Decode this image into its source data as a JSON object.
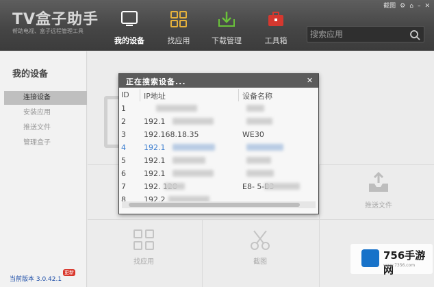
{
  "app": {
    "logo_title": "TV盒子助手",
    "logo_subtitle": "帮助电视、盒子远程管理工具",
    "window_controls": {
      "skin_label": "截图",
      "icons": [
        "gear-icon",
        "feedback-icon",
        "minimize-icon",
        "close-icon"
      ]
    }
  },
  "nav": {
    "items": [
      {
        "label": "我的设备",
        "icon": "monitor-icon",
        "color": "#ffffff",
        "active": true
      },
      {
        "label": "找应用",
        "icon": "grid-icon",
        "color": "#e7b23c",
        "active": false
      },
      {
        "label": "下载管理",
        "icon": "download-icon",
        "color": "#6ac23a",
        "active": false
      },
      {
        "label": "工具箱",
        "icon": "toolbox-icon",
        "color": "#d5382f",
        "active": false
      }
    ]
  },
  "search": {
    "placeholder": "搜索应用"
  },
  "sidebar": {
    "title": "我的设备",
    "items": [
      {
        "label": "连接设备",
        "active": true
      },
      {
        "label": "安装应用",
        "active": false
      },
      {
        "label": "推送文件",
        "active": false
      },
      {
        "label": "管理盒子",
        "active": false
      }
    ],
    "version": "当前版本 3.0.42.1",
    "update_badge": "更新"
  },
  "tiles": {
    "push_file": "推送文件",
    "find_app": "找应用",
    "screenshot": "截图"
  },
  "dialog": {
    "title": "正在搜索设备...",
    "columns": [
      "ID",
      "IP地址",
      "设备名称"
    ],
    "rows": [
      {
        "id": "1",
        "ip": "",
        "name": ""
      },
      {
        "id": "2",
        "ip": "192.1",
        "name": ""
      },
      {
        "id": "3",
        "ip": "192.168.18.35",
        "name": "WE30"
      },
      {
        "id": "4",
        "ip": "192.1",
        "name": "",
        "selected": true
      },
      {
        "id": "5",
        "ip": "192.1",
        "name": ""
      },
      {
        "id": "6",
        "ip": "192.1",
        "name": ""
      },
      {
        "id": "7",
        "ip": "192.    128",
        "name": "E8-             5-B3"
      },
      {
        "id": "8",
        "ip": "192.2",
        "name": ""
      }
    ]
  },
  "watermark": {
    "text": "756手游网",
    "url": "www.7356.com"
  },
  "colors": {
    "topbar": "#474747",
    "sidebar_active": "#bfbfbf",
    "selected_row": "#3c7ed0",
    "version_text": "#1e4fa8"
  }
}
